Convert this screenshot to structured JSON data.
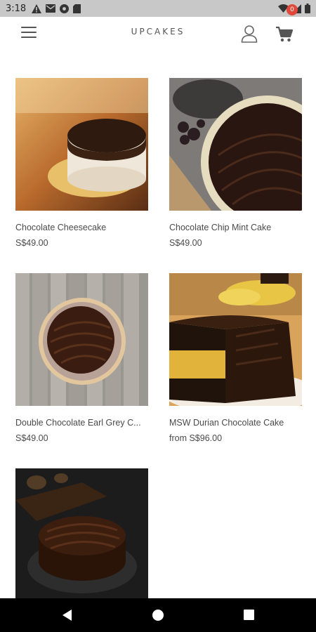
{
  "status_bar": {
    "time": "3:18",
    "left_icons": [
      "alert-icon",
      "mail-icon",
      "chrome-icon",
      "sd-card-icon"
    ],
    "right_icons": [
      "wifi-icon",
      "signal-icon",
      "battery-icon"
    ]
  },
  "header": {
    "brand": "UPCAKES",
    "cart_count": "0"
  },
  "products": [
    {
      "name": "Chocolate Cheesecake",
      "price": "S$49.00"
    },
    {
      "name": "Chocolate Chip Mint Cake",
      "price": "S$49.00"
    },
    {
      "name": "Double Chocolate Earl Grey C...",
      "price": "S$49.00"
    },
    {
      "name": "MSW Durian Chocolate Cake",
      "price": "from S$96.00"
    },
    {
      "name": "",
      "price": ""
    }
  ],
  "nav": {
    "icons": [
      "back-icon",
      "home-icon",
      "recents-icon"
    ]
  },
  "colors": {
    "status_bar": "#c8c8c8",
    "badge": "#e0483b",
    "text": "#4a4a4a"
  }
}
